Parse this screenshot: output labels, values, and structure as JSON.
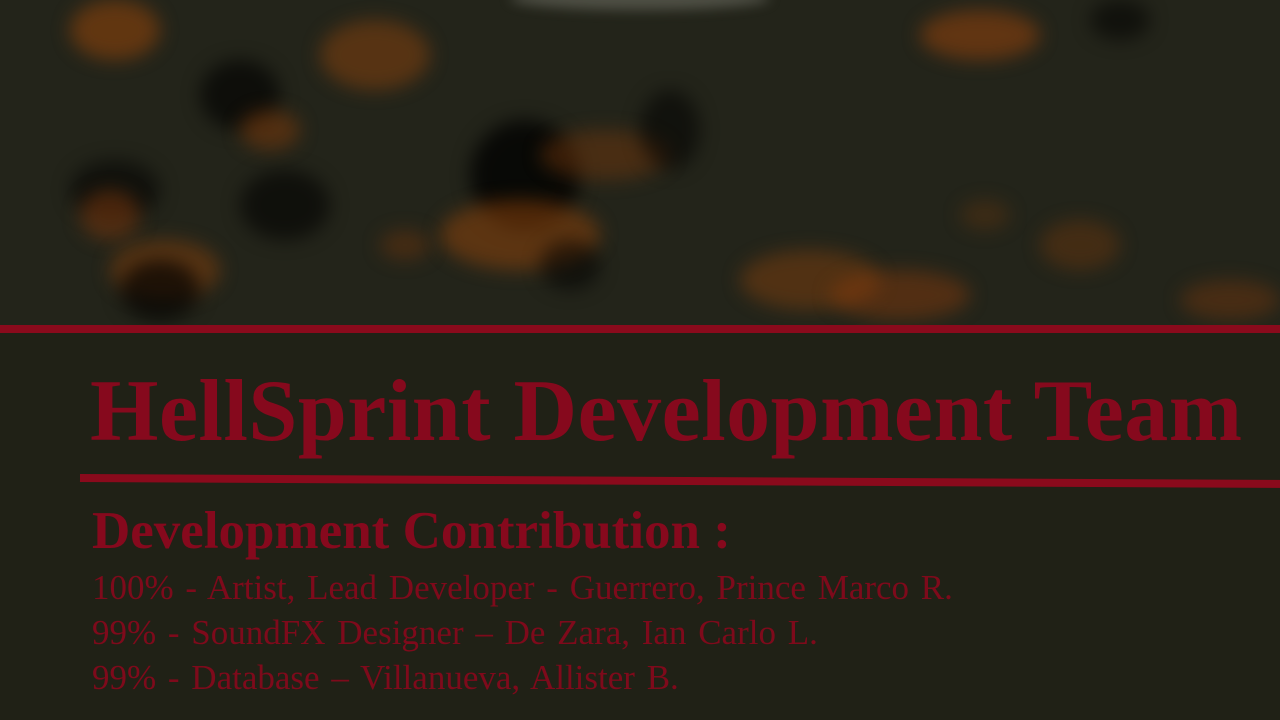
{
  "screen": {
    "title": "HellSprint Development Team",
    "subtitle": "Development Contribution :",
    "credits": [
      "100% - Artist, Lead Developer - Guerrero, Prince Marco R.",
      "99% - SoundFX Designer – De Zara, Ian Carlo L.",
      "99% - Database – Villanueva, Allister B."
    ]
  },
  "colors": {
    "background": "#202116",
    "accent_red": "#8a0a1c",
    "ember_orange": "#7a3a0a"
  }
}
